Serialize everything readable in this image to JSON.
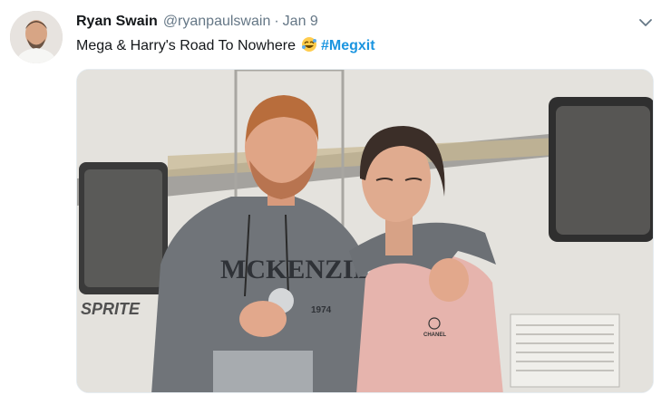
{
  "tweet": {
    "author_name": "Ryan Swain",
    "author_handle": "@ryanpaulswain",
    "separator": "·",
    "date": "Jan 9",
    "text": "Mega & Harry's Road To Nowhere",
    "emoji": "rolling-on-floor-laughing-emoji",
    "hashtag": "#Megxit"
  },
  "photo": {
    "caravan_brand": "SPRITE",
    "sweatshirt_text": "MCKENZIE",
    "sweatshirt_year": "1974",
    "shirt_logo_text": "CHANEL"
  },
  "colors": {
    "name": "#14171a",
    "meta": "#657786",
    "hashtag": "#1b95e0"
  },
  "icons": {
    "menu": "chevron-down-icon"
  }
}
